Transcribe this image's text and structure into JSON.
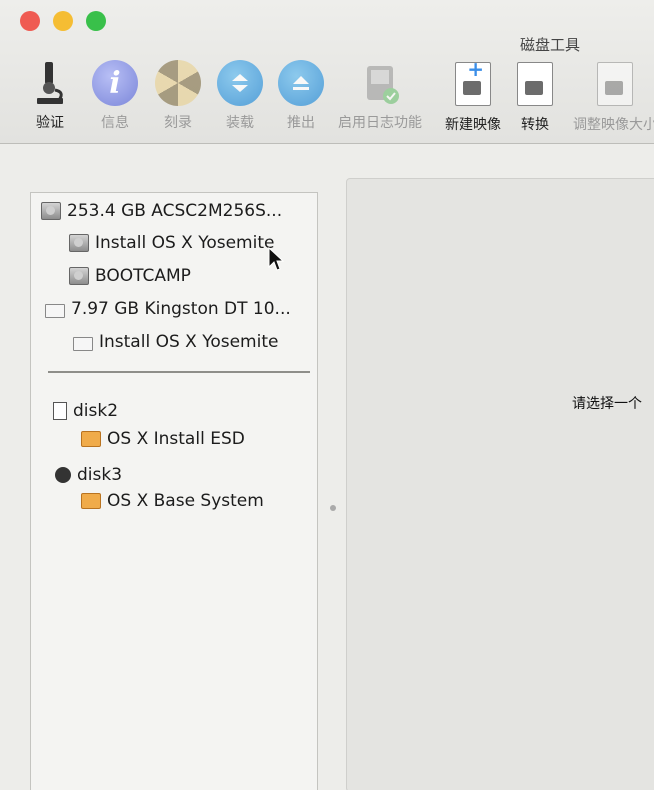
{
  "window": {
    "title": "磁盘工具"
  },
  "toolbar": {
    "verify": "验证",
    "info": "信息",
    "burn": "刻录",
    "mount": "装载",
    "eject": "推出",
    "enable_journaling": "启用日志功能",
    "new_image": "新建映像",
    "convert": "转换",
    "resize_image": "调整映像大小"
  },
  "sidebar": {
    "items": [
      {
        "label": "253.4 GB ACSC2M256S...",
        "icon": "internal-disk-icon"
      },
      {
        "label": "Install OS X Yosemite",
        "icon": "internal-volume-icon"
      },
      {
        "label": "BOOTCAMP",
        "icon": "internal-volume-icon"
      },
      {
        "label": "7.97 GB Kingston DT 10...",
        "icon": "usb-disk-icon"
      },
      {
        "label": "Install OS X Yosemite",
        "icon": "usb-volume-icon"
      }
    ],
    "images": [
      {
        "label": "disk2",
        "icon": "disk-image-icon"
      },
      {
        "label": "OS X Install ESD",
        "icon": "mounted-volume-icon"
      },
      {
        "label": "disk3",
        "icon": "globe-disk-icon"
      },
      {
        "label": "OS X Base System",
        "icon": "mounted-volume-icon"
      }
    ]
  },
  "main": {
    "prompt": "请选择一个"
  }
}
